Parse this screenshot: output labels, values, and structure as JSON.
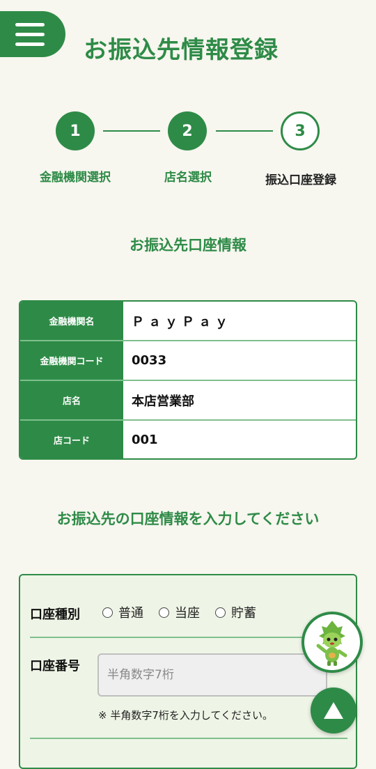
{
  "header": {
    "title": "お振込先情報登録",
    "menu_icon": "hamburger-menu-icon"
  },
  "steps": [
    {
      "number": "1",
      "label": "金融機関選択",
      "state": "done"
    },
    {
      "number": "2",
      "label": "店名選択",
      "state": "done"
    },
    {
      "number": "3",
      "label": "振込口座登録",
      "state": "current"
    }
  ],
  "account_info": {
    "title": "お振込先口座情報",
    "rows": [
      {
        "key": "金融機関名",
        "value": "ＰａｙＰａｙ"
      },
      {
        "key": "金融機関コード",
        "value": "0033"
      },
      {
        "key": "店名",
        "value": "本店営業部"
      },
      {
        "key": "店コード",
        "value": "001"
      }
    ]
  },
  "form": {
    "title": "お振込先の口座情報を入力してください",
    "account_type_label": "口座種別",
    "account_types": [
      "普通",
      "当座",
      "貯蓄"
    ],
    "account_number_label": "口座番号",
    "account_number_placeholder": "半角数字7桁",
    "account_number_value": "",
    "account_number_note": "※ 半角数字7桁を入力してください。"
  },
  "floating": {
    "mascot_icon": "mascot-icon",
    "scroll_top_icon": "arrow-up-icon"
  },
  "colors": {
    "brand_green": "#2e8b47",
    "light_green": "#7fbf8d",
    "background": "#f7f6ef"
  }
}
